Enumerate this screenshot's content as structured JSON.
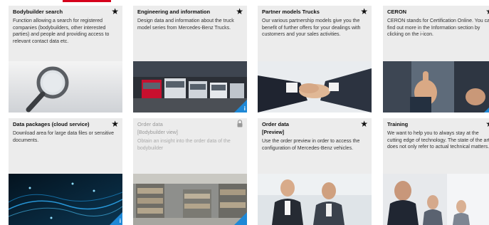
{
  "cards": [
    {
      "title": "Bodybuilder search",
      "subtitle": "",
      "description": "Function allowing a search for registered companies (bodybuilders, other interested parties) and people and providing access to relevant contact data etc.",
      "icon": "star-icon",
      "badge": ""
    },
    {
      "title": "Engineering and information",
      "subtitle": "",
      "description": "Design data and information about the truck model series from Mercedes-Benz Trucks.",
      "icon": "star-icon",
      "badge": "i"
    },
    {
      "title": "Partner models Trucks",
      "subtitle": "",
      "description": "Our various partnership models give you the benefit of further offers for your dealings with customers and your sales activities.",
      "icon": "star-icon",
      "badge": ""
    },
    {
      "title": "CERON",
      "subtitle": "",
      "description": "CERON stands for Certification Online. You can find out more in the Information section by clicking on the i-icon.",
      "icon": "star-icon",
      "badge": "i"
    },
    {
      "title": "Data packages (cloud service)",
      "subtitle": "",
      "description": "Download area for large data files or sensitive documents.",
      "icon": "star-icon",
      "badge": "i"
    },
    {
      "title": "Order data",
      "subtitle": "[Bodybuilder view]",
      "description": "Obtain an insight into the order data of the bodybuilder",
      "icon": "lock-icon",
      "badge": ""
    },
    {
      "title": "Order data",
      "subtitle": "[Preview]",
      "description": "Use the order preview in order to access the configuration of Mercedes-Benz vehicles.",
      "icon": "star-icon",
      "badge": ""
    },
    {
      "title": "Training",
      "subtitle": "",
      "description": "We want to help you to always stay at the cutting edge of technology. The state of the art does not only refer to actual technical matters.",
      "icon": "star-icon",
      "badge": ""
    }
  ],
  "colors": {
    "accent_red": "#d6001c",
    "info_blue": "#1e88d6",
    "card_bg": "#ececec"
  }
}
